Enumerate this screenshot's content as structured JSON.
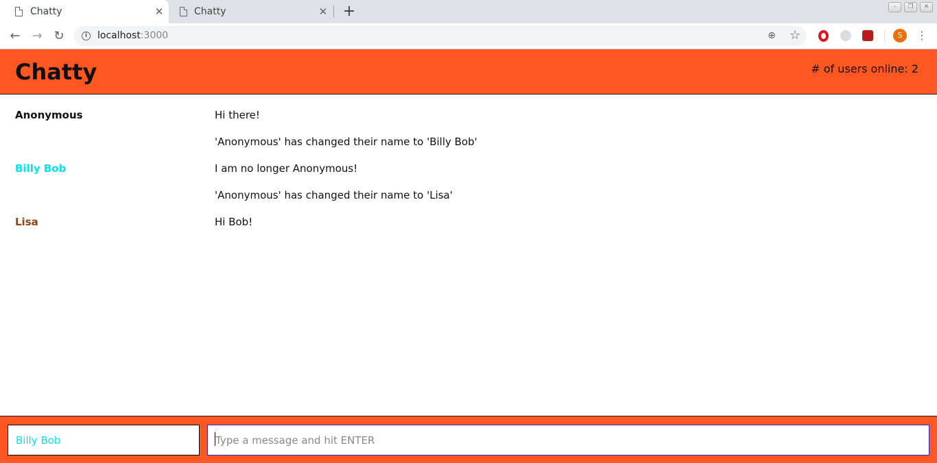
{
  "browser": {
    "tabs": [
      {
        "title": "Chatty",
        "close": "✕"
      },
      {
        "title": "Chatty",
        "close": "✕"
      }
    ],
    "new_tab": "+",
    "url_host": "localhost",
    "url_port": ":3000",
    "profile_initial": "S"
  },
  "app": {
    "title": "Chatty",
    "users_online": "# of users online: 2"
  },
  "messages": [
    {
      "user": "Anonymous",
      "content": "Hi there!",
      "color": "#111111"
    },
    {
      "user": "",
      "content": "'Anonymous' has changed their name to 'Billy Bob'",
      "color": "#111111"
    },
    {
      "user": "Billy Bob",
      "content": "I am no longer Anonymous!",
      "color": "#00e5ee"
    },
    {
      "user": "",
      "content": "'Anonymous' has changed their name to 'Lisa'",
      "color": "#111111"
    },
    {
      "user": "Lisa",
      "content": "Hi Bob!",
      "color": "#8b4513"
    }
  ],
  "chatbar": {
    "username_value": "Billy Bob",
    "message_placeholder": "Type a message and hit ENTER"
  },
  "colors": {
    "accent": "#ff5722"
  }
}
